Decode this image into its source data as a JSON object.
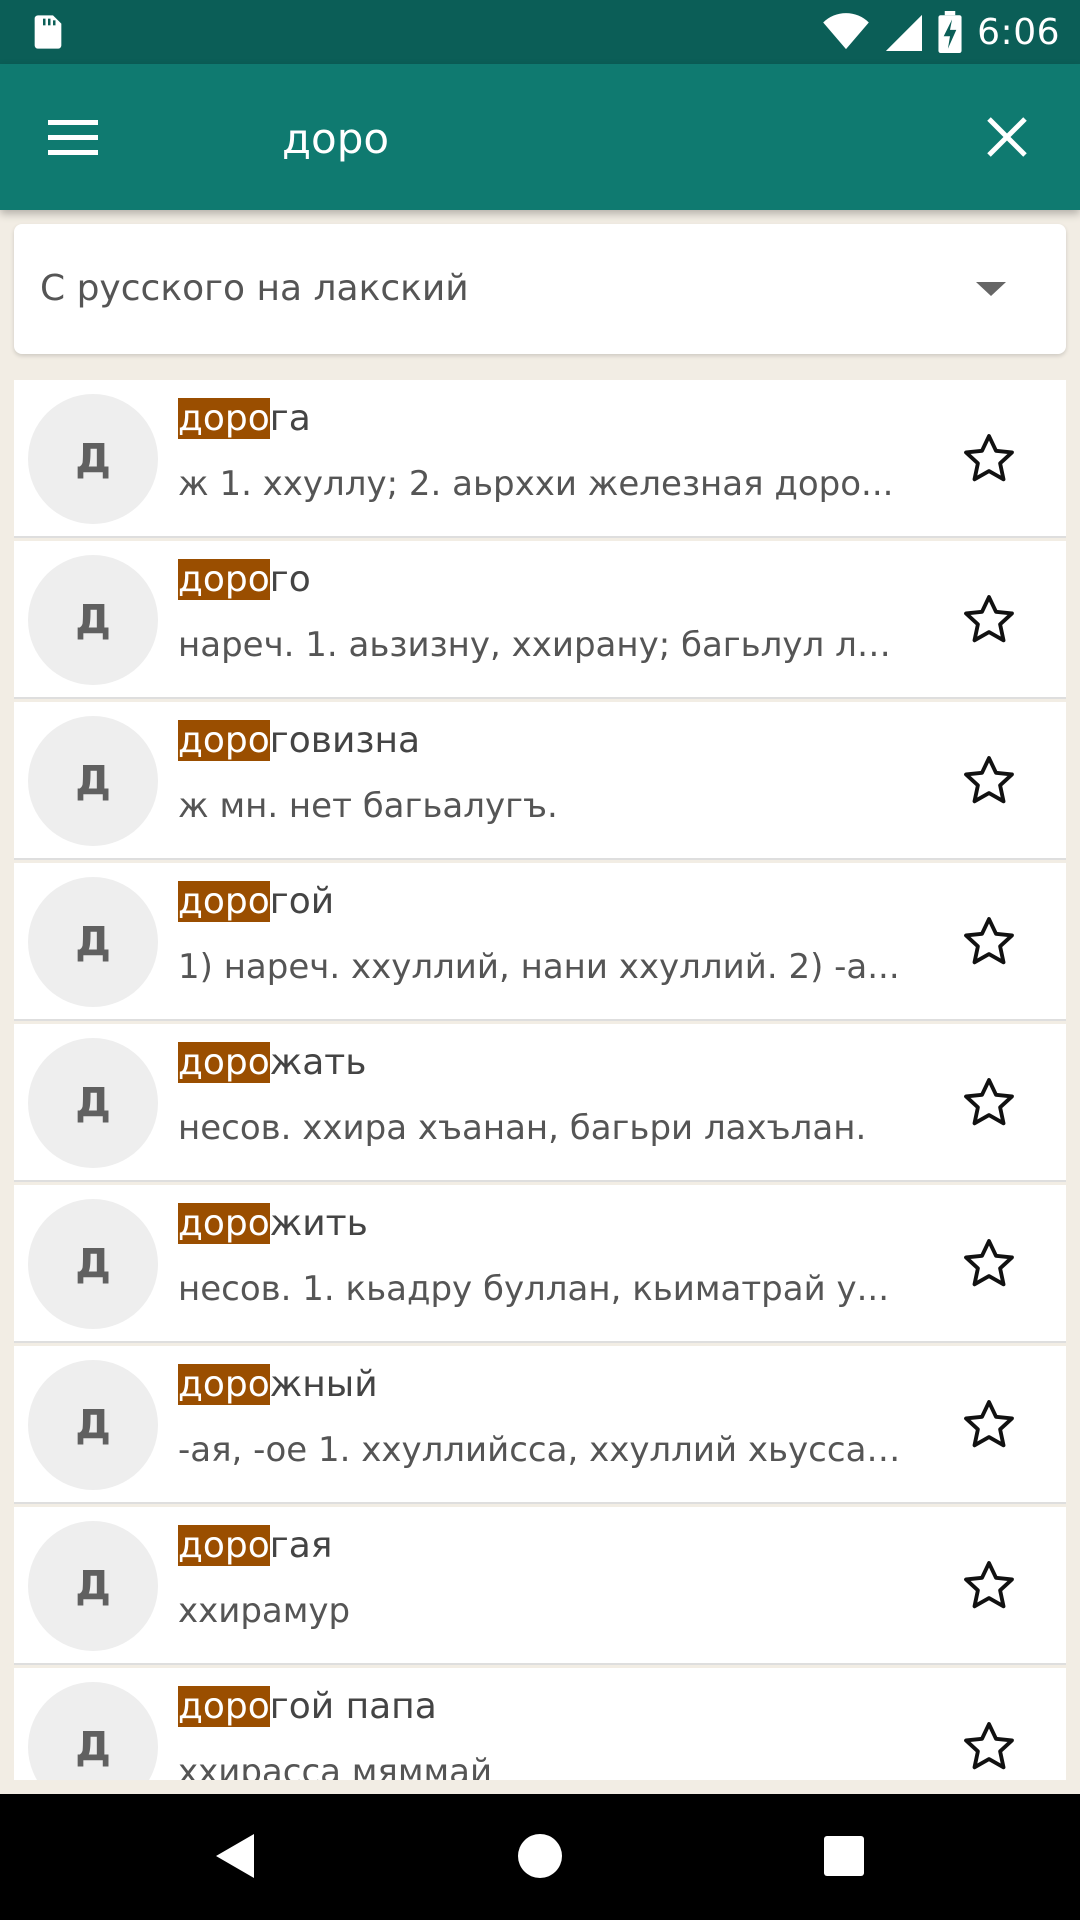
{
  "status_bar": {
    "time": "6:06",
    "icons": [
      "sd-card-icon",
      "wifi-icon",
      "signal-icon",
      "battery-charging-icon"
    ]
  },
  "app_bar": {
    "search_value": "доро",
    "menu_icon": "menu-icon",
    "close_icon": "close-icon"
  },
  "dropdown": {
    "selected": "С русского на лакский"
  },
  "colors": {
    "status_bar": "#0b5e57",
    "app_bar": "#0f7a70",
    "highlight": "#9a4e00",
    "background": "#f2ede4"
  },
  "results": [
    {
      "letter": "Д",
      "match": "доро",
      "rest": "га",
      "definition": "ж 1. хxуллу; 2. аьрxxи  железная доро..."
    },
    {
      "letter": "Д",
      "match": "доро",
      "rest": "го",
      "definition": "нареч. 1. аьзизну, хxирану; багьлул ла..."
    },
    {
      "letter": "Д",
      "match": "доро",
      "rest": "говизна",
      "definition": "ж мн. нет багьалугъ."
    },
    {
      "letter": "Д",
      "match": "доро",
      "rest": "гой",
      "definition": "1) нареч. хxуллий, нани хxуллий. 2) -а..."
    },
    {
      "letter": "Д",
      "match": "доро",
      "rest": "жать",
      "definition": "несов. хxира хъанан, багьри лахълан."
    },
    {
      "letter": "Д",
      "match": "доро",
      "rest": "жить",
      "definition": "несов. 1. кьадру буллан, кьиматрай у..."
    },
    {
      "letter": "Д",
      "match": "доро",
      "rest": "жный",
      "definition": "-ая, -ое 1. хxуллийсса, хxуллий хьусса,..."
    },
    {
      "letter": "Д",
      "match": "доро",
      "rest": "гая",
      "definition": "хxирамур"
    },
    {
      "letter": "Д",
      "match": "доро",
      "rest": "гой папа",
      "definition": "хxирасса мяммай"
    }
  ]
}
